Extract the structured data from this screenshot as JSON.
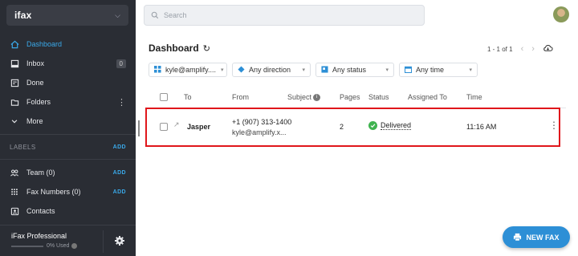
{
  "sidebar": {
    "brand": "ifax",
    "nav": [
      {
        "label": "Dashboard",
        "icon": "home-icon",
        "active": true
      },
      {
        "label": "Inbox",
        "icon": "inbox-icon",
        "count": "0"
      },
      {
        "label": "Done",
        "icon": "done-icon"
      },
      {
        "label": "Folders",
        "icon": "folder-icon"
      },
      {
        "label": "More",
        "icon": "chevron-down-icon"
      }
    ],
    "labels_heading": "LABELS",
    "labels_add": "ADD",
    "teams": [
      {
        "label": "Team (0)",
        "icon": "team-icon",
        "action": "ADD"
      },
      {
        "label": "Fax Numbers (0)",
        "icon": "dialpad-icon",
        "action": "ADD"
      },
      {
        "label": "Contacts",
        "icon": "contacts-icon"
      }
    ],
    "footer": {
      "plan": "iFax Professional",
      "usage": "0% Used"
    }
  },
  "topbar": {
    "search_placeholder": "Search"
  },
  "main": {
    "title": "Dashboard",
    "pager": "1 - 1 of 1",
    "filters": [
      {
        "label": "kyle@amplify....",
        "icon": "user-grid-icon"
      },
      {
        "label": "Any direction",
        "icon": "direction-icon"
      },
      {
        "label": "Any status",
        "icon": "status-icon"
      },
      {
        "label": "Any time",
        "icon": "calendar-icon"
      }
    ],
    "columns": [
      "To",
      "From",
      "Subject",
      "Pages",
      "Status",
      "Assigned To",
      "Time"
    ],
    "rows": [
      {
        "to": "Jasper",
        "from_number": "+1 (907) 313-1400",
        "from_email": "kyle@amplify.x...",
        "subject": "",
        "pages": "2",
        "status": "Delivered",
        "assigned_to": "",
        "time": "11:16 AM"
      }
    ],
    "new_fax_label": "NEW FAX"
  },
  "colors": {
    "accent": "#3aa8e8",
    "fab": "#2d8fd6",
    "delivered": "#3fb34f",
    "highlight": "#e0161b",
    "sidebar": "#2a2d34"
  }
}
